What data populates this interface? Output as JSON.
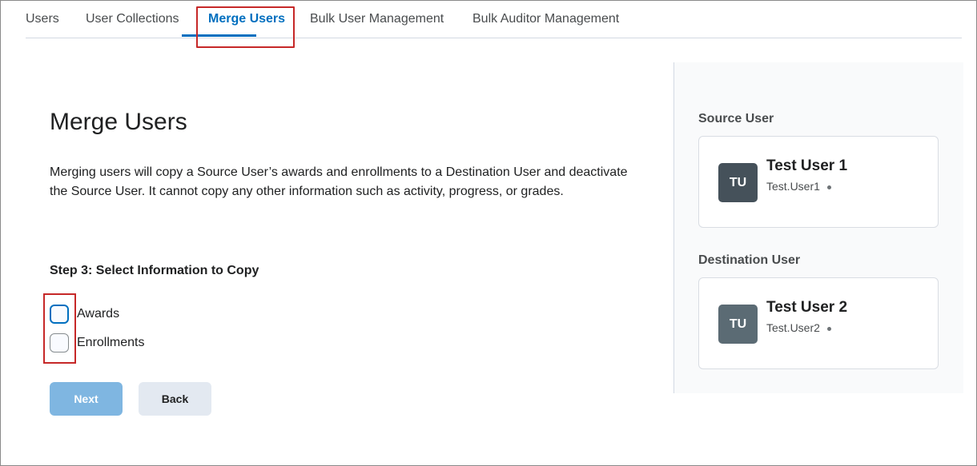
{
  "tabs": [
    {
      "label": "Users"
    },
    {
      "label": "User Collections"
    },
    {
      "label": "Merge Users",
      "active": true
    },
    {
      "label": "Bulk User Management"
    },
    {
      "label": "Bulk Auditor Management"
    }
  ],
  "page": {
    "title": "Merge Users",
    "description": "Merging users will copy a Source User’s awards and enrollments to a Destination User and deactivate the Source User. It cannot copy any other information such as activity, progress, or grades."
  },
  "step": {
    "title": "Step 3: Select Information to Copy",
    "options": [
      {
        "label": "Awards",
        "checked": false
      },
      {
        "label": "Enrollments",
        "checked": false
      }
    ]
  },
  "buttons": {
    "next": "Next",
    "back": "Back"
  },
  "source": {
    "heading": "Source User",
    "initials": "TU",
    "name": "Test User 1",
    "username": "Test.User1",
    "avatar_color": "#45515a"
  },
  "destination": {
    "heading": "Destination User",
    "initials": "TU",
    "name": "Test User 2",
    "username": "Test.User2",
    "avatar_color": "#5b6b74"
  },
  "colors": {
    "accent": "#006fbf",
    "highlight": "#c62828"
  }
}
